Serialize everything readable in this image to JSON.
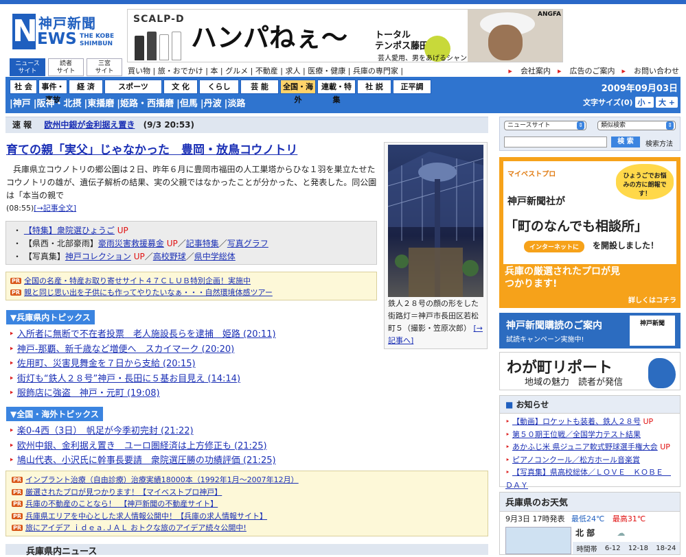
{
  "logo": {
    "kanji": "神戸新聞",
    "letters": "EWS",
    "initial": "N",
    "sub": "THE KOBE SHIMBUN"
  },
  "banner": {
    "brand": "SCALP-D",
    "headline": "ハンパねぇ〜",
    "talent_line1": "トータル",
    "talent_line2": "テンポス藤田",
    "slogan": "芸人愛用、男をあげるシャンプー!?",
    "maker": "ANGFA"
  },
  "site_tabs": [
    {
      "label_1": "ニュース",
      "label_2": "サイト"
    },
    {
      "label_1": "読者",
      "label_2": "サイト"
    },
    {
      "label_1": "三宮",
      "label_2": "サイト"
    }
  ],
  "category_links": [
    "買い物",
    "旅・おでかけ",
    "本",
    "グルメ",
    "不動産",
    "求人",
    "医療・健康",
    "兵庫の専門家"
  ],
  "corporate_links": [
    "会社案内",
    "広告のご案内",
    "お問い合わせ"
  ],
  "nav_sections": [
    "社 会",
    "事件・事故",
    "経 済",
    "スポーツ",
    "文 化",
    "くらし",
    "芸 能",
    "全国・海外",
    "連載・特集",
    "社 説",
    "正平調"
  ],
  "nav_regions": [
    "神戸",
    "阪神・北摂",
    "東播磨",
    "姫路・西播磨",
    "但馬",
    "丹波",
    "淡路"
  ],
  "date": "2009年09月03日",
  "font_size": {
    "label": "文字サイズ(0)",
    "small": "小 -",
    "large": "大 +"
  },
  "breaking": {
    "label": "速 報",
    "headline": "欧州中銀が金利据え置き",
    "time": "(9/3 20:53)"
  },
  "main_story": {
    "headline": "育ての親「実父」じゃなかった　豊岡・放鳥コウノトリ",
    "lead": "兵庫県立コウノトリの郷公園は２日、昨年６月に豊岡市福田の人工巣塔からひな１羽を巣立たせたコウノトリの雄が、遺伝子解析の結果、実の父親ではなかったことが分かった、と発表した。同公園は「本当の親で",
    "time": "(08:55)",
    "more": "[→記事全文]"
  },
  "special_links": [
    {
      "prefix": "【特集】",
      "title": "衆院選ひょうご",
      "up": "UP",
      "extra": []
    },
    {
      "prefix": "【県西・北部豪雨】",
      "title": "豪雨災害救援募金",
      "up": "UP",
      "extra": [
        "記事特集",
        "写真グラフ"
      ]
    },
    {
      "prefix": "【写真集】",
      "title": "神戸コレクション",
      "up": "UP",
      "extra": [
        "高校野球",
        "県中学総体"
      ]
    }
  ],
  "pr_top": [
    {
      "tag": "PR",
      "text": "全国の名産・特産お取り寄せサイト４７ＣＬＵＢ特別企画！実施中"
    },
    {
      "tag": "PR",
      "text": "親と同じ思い出を子供にも作ってやりたいなぁ・・・自然環境体感ツアー"
    }
  ],
  "hyogo_topics": {
    "title": "▼兵庫県内トピックス",
    "items": [
      "入所者に無断で不在者投票　老人施設長らを逮捕　姫路 (20:11)",
      "神戸-那覇、新千歳など増便へ　スカイマーク (20:20)",
      "佐用町、災害見舞金を７日から支給 (20:15)",
      "街灯も“鉄人２８号”神戸・長田に５基お目見え (14:14)",
      "服飾店に強盗　神戸・元町 (19:08)"
    ]
  },
  "world_topics": {
    "title": "▼全国・海外トピックス",
    "items": [
      "楽0-4西（3日）　帆足が今季初完封 (21:22)",
      "欧州中銀、金利据え置き　ユーロ圏経済は上方修正も (21:25)",
      "鳩山代表、小沢氏に幹事長要請　衆院選圧勝の功績評価 (21:25)"
    ]
  },
  "photo": {
    "caption": "鉄人２８号の顔の形をした街路灯＝神戸市長田区若松町５（撮影・笠原次郎）",
    "more": "[→記事へ]"
  },
  "pr_bottom": [
    {
      "tag": "PR",
      "text": "インプラント治療（自由診療）治療実績18000本（1992年1月〜2007年12月）"
    },
    {
      "tag": "PR",
      "text": "厳選されたプロが見つかります！【マイベストプロ神戸】"
    },
    {
      "tag": "PR",
      "text": "兵庫の不動産のことなら！　【神戸新聞の不動産サイト】"
    },
    {
      "tag": "PR",
      "text": "兵庫県エリアを中心とした求人情報公開中！【兵庫の求人情報サイト】"
    },
    {
      "tag": "PR",
      "text": "旅にアイデア ｉｄｅａ.ＪＡＬ おトクな旅のアイデア続々公開中!"
    }
  ],
  "bottom_section": "兵庫県内ニュース",
  "search": {
    "site_select": "ニュースサイト",
    "mode_select": "類似検索",
    "button": "検 索",
    "help": "検索方法"
  },
  "ad_mybestpro": {
    "logo": "マイベストプロ",
    "bubble": "ひょうごでお悩みの方に朗報です！",
    "line1": "神戸新聞社が",
    "line2": "「町のなんでも相談所」",
    "pill": "インターネットに",
    "line3": "を開設しました！",
    "bottom": "兵庫の厳選されたプロが見つかります!",
    "more": "詳しくはコチラ"
  },
  "ad_subscribe": {
    "title": "神戸新聞購読のご案内",
    "sub": "試読キャンペーン実施中!",
    "paper": "神戸新聞"
  },
  "ad_report": {
    "title": "わが町リポート",
    "sub": "地域の魅力　読者が発信"
  },
  "notices": {
    "title": "お知らせ",
    "items": [
      {
        "text": "【動画】ロケットも装着、鉄人２８号",
        "up": "UP"
      },
      {
        "text": "第５０期王位戦／全国学力テスト結果",
        "up": ""
      },
      {
        "text": "あかふじ米 県ジュニア軟式野球選手権大会",
        "up": "UP"
      },
      {
        "text": "ピアノコンクール／松方ホール音楽賞",
        "up": ""
      },
      {
        "text": "【写真集】県高校総体／ＬＯＶＥ　ＫＯＢＥ　ＤＡＹ",
        "up": ""
      }
    ]
  },
  "weather": {
    "title": "兵庫県のお天気",
    "issued": "9月3日 17時発表",
    "low_label": "最低",
    "low": "24℃",
    "high_label": "最高",
    "high": "31℃",
    "region": "北 部",
    "cols": [
      "時間帯",
      "6-12",
      "12-18",
      "18-24"
    ]
  },
  "colors": {
    "brand": "#1f5fbf",
    "nav": "#2f74cf",
    "up": "#e01010",
    "ad_orange": "#f6a21a"
  }
}
